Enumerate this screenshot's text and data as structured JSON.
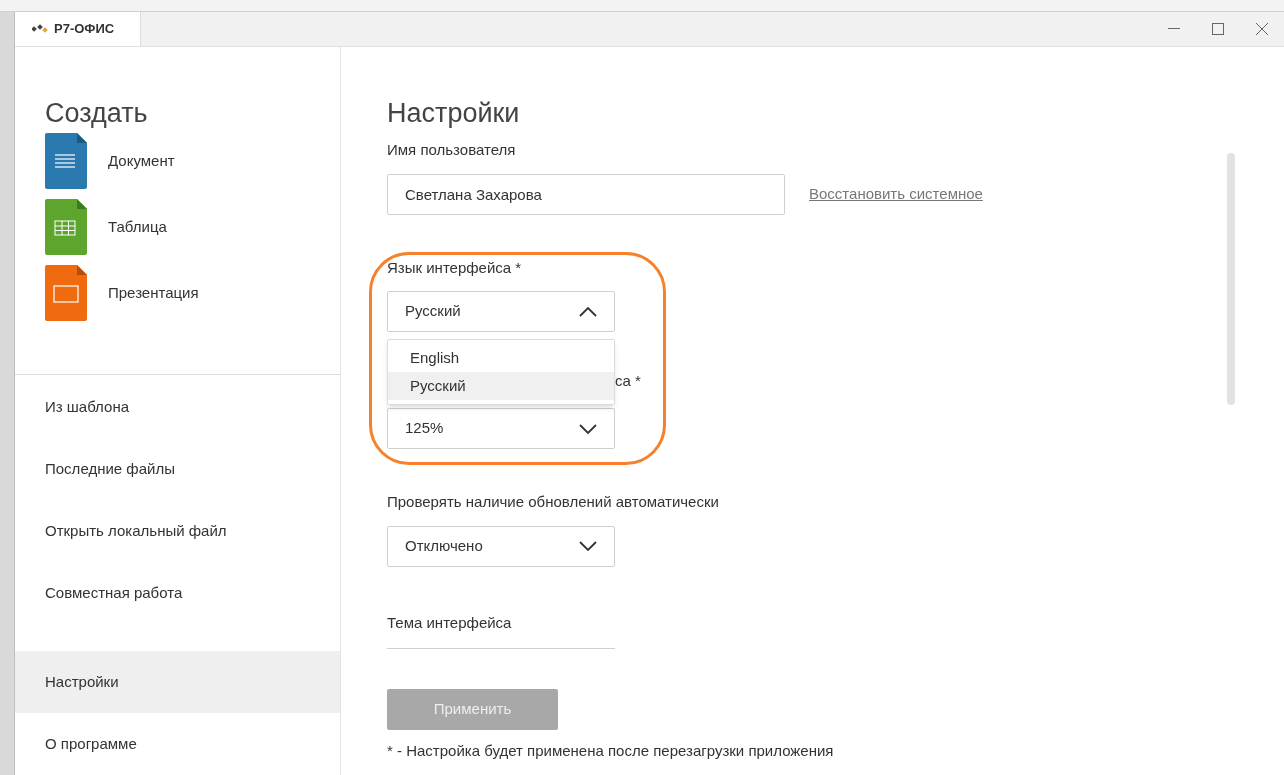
{
  "window": {
    "tab": "Р7-ОФИС"
  },
  "create": {
    "title": "Создать",
    "items": [
      {
        "kind": "document",
        "label": "Документ"
      },
      {
        "kind": "spreadsheet",
        "label": "Таблица"
      },
      {
        "kind": "presentation",
        "label": "Презентация"
      }
    ]
  },
  "sidebar": {
    "items": [
      {
        "label": "Из шаблона",
        "selected": false
      },
      {
        "label": "Последние файлы",
        "selected": false
      },
      {
        "label": "Открыть локальный файл",
        "selected": false
      },
      {
        "label": "Совместная работа",
        "selected": false
      },
      {
        "label": "Настройки",
        "selected": true
      },
      {
        "label": "О программе",
        "selected": false
      }
    ]
  },
  "settings": {
    "title": "Настройки",
    "user_name_label": "Имя пользователя",
    "user_name": "Светлана Захарова",
    "restore_link": "Восстановить системное",
    "language": {
      "label": "Язык интерфейса *",
      "value": "Русский",
      "expanded": true,
      "options": [
        {
          "label": "English",
          "selected": false
        },
        {
          "label": "Русский",
          "selected": true
        }
      ]
    },
    "scale": {
      "label": "са *",
      "value": "125%"
    },
    "updates": {
      "label": "Проверять наличие обновлений автоматически",
      "value": "Отключено"
    },
    "theme": {
      "label": "Тема интерфейса"
    },
    "apply_button": {
      "label": "Применить",
      "disabled": true
    },
    "note": "* - Настройка будет применена после перезагрузки приложения"
  }
}
